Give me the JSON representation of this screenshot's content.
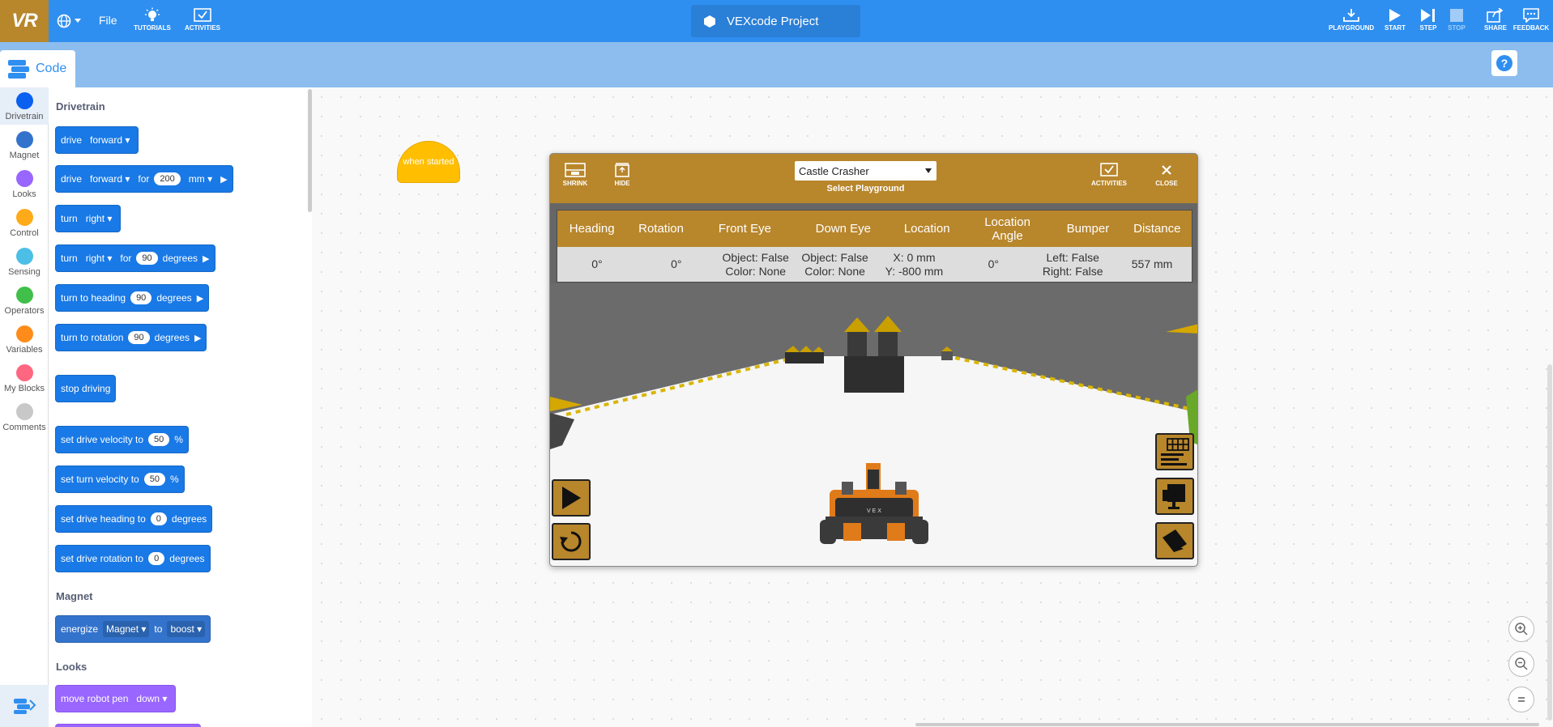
{
  "app": {
    "logo": "VR",
    "file_label": "File",
    "project_title": "VEXcode Project"
  },
  "toolbar": {
    "tutorials": "TUTORIALS",
    "activities": "ACTIVITIES",
    "playground": "PLAYGROUND",
    "start": "START",
    "step": "STEP",
    "stop": "STOP",
    "share": "SHARE",
    "feedback": "FEEDBACK"
  },
  "tabs": {
    "code": "Code"
  },
  "categories": [
    {
      "label": "Drivetrain",
      "color": "#0a60ef"
    },
    {
      "label": "Magnet",
      "color": "#3373cc"
    },
    {
      "label": "Looks",
      "color": "#9966ff"
    },
    {
      "label": "Control",
      "color": "#ffab19"
    },
    {
      "label": "Sensing",
      "color": "#4cbfe6"
    },
    {
      "label": "Operators",
      "color": "#40bf4a"
    },
    {
      "label": "Variables",
      "color": "#ff8c1a"
    },
    {
      "label": "My Blocks",
      "color": "#ff6680"
    },
    {
      "label": "Comments",
      "color": "#c8c8c8"
    }
  ],
  "flyout": {
    "drivetrain_title": "Drivetrain",
    "magnet_title": "Magnet",
    "looks_title": "Looks",
    "b1": {
      "t1": "drive",
      "d1": "forward"
    },
    "b2": {
      "t1": "drive",
      "d1": "forward",
      "t2": "for",
      "n1": "200",
      "d2": "mm"
    },
    "b3": {
      "t1": "turn",
      "d1": "right"
    },
    "b4": {
      "t1": "turn",
      "d1": "right",
      "t2": "for",
      "n1": "90",
      "t3": "degrees"
    },
    "b5": {
      "t1": "turn to heading",
      "n1": "90",
      "t2": "degrees"
    },
    "b6": {
      "t1": "turn to rotation",
      "n1": "90",
      "t2": "degrees"
    },
    "b7": {
      "t1": "stop driving"
    },
    "b8": {
      "t1": "set drive velocity to",
      "n1": "50",
      "t2": "%"
    },
    "b9": {
      "t1": "set turn velocity to",
      "n1": "50",
      "t2": "%"
    },
    "b10": {
      "t1": "set drive heading to",
      "n1": "0",
      "t2": "degrees"
    },
    "b11": {
      "t1": "set drive rotation to",
      "n1": "0",
      "t2": "degrees"
    },
    "b12": {
      "t1": "energize",
      "d1": "Magnet",
      "t2": "to",
      "d2": "boost"
    },
    "b13": {
      "t1": "move robot pen",
      "d1": "down"
    }
  },
  "workspace": {
    "hat_block": "when started"
  },
  "playground": {
    "shrink": "SHRINK",
    "hide": "HIDE",
    "selected": "Castle Crasher",
    "select_caption": "Select Playground",
    "activities": "ACTIVITIES",
    "close": "CLOSE",
    "headers": [
      "Heading",
      "Rotation",
      "Front Eye",
      "Down Eye",
      "Location",
      "Location Angle",
      "Bumper",
      "Distance"
    ],
    "values": {
      "heading": "0°",
      "rotation": "0°",
      "front_eye_1": "Object: False",
      "front_eye_2": "Color: None",
      "down_eye_1": "Object: False",
      "down_eye_2": "Color: None",
      "location_1": "X: 0 mm",
      "location_2": "Y: -800 mm",
      "location_angle": "0°",
      "bumper_1": "Left: False",
      "bumper_2": "Right: False",
      "distance": "557 mm"
    },
    "header_color": "#b8862b"
  }
}
